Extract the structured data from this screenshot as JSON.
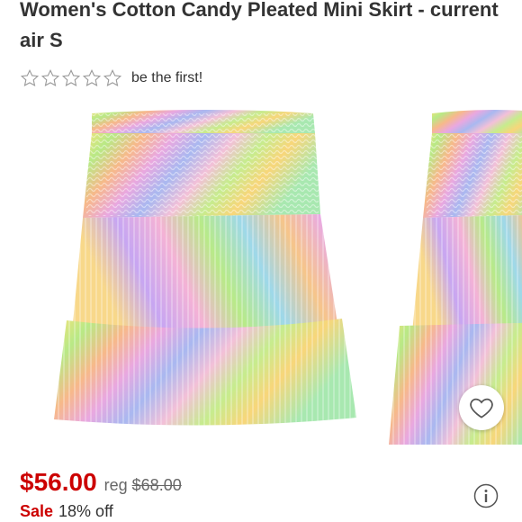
{
  "product": {
    "title": "Women's Cotton Candy Pleated Mini Skirt - current air S",
    "rating_text": "be the first!",
    "star_count": 5,
    "image_alt": "Pastel tie-dye tiered pleated mini skirt"
  },
  "pricing": {
    "price": "$56.00",
    "reg_label": "reg",
    "reg_price": "$68.00",
    "sale_label": "Sale",
    "discount": "18% off"
  },
  "icons": {
    "star": "star-outline-icon",
    "favorite": "heart-outline-icon",
    "info": "info-icon"
  },
  "colors": {
    "sale_red": "#cc0000",
    "text": "#333333",
    "muted": "#666666"
  }
}
